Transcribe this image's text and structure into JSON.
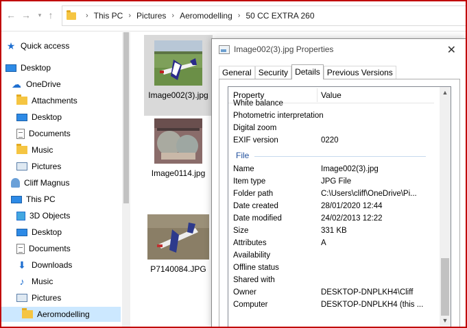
{
  "address_bar": {
    "back_icon": "back-arrow-icon",
    "forward_icon": "forward-arrow-icon",
    "up_icon": "up-arrow-icon",
    "breadcrumbs": [
      "This PC",
      "Pictures",
      "Aeromodelling",
      "50 CC EXTRA 260"
    ]
  },
  "sidebar": {
    "items": [
      {
        "label": "Quick access",
        "icon": "star-icon"
      },
      {
        "label": "Desktop",
        "icon": "desktop-icon"
      },
      {
        "label": "OneDrive",
        "icon": "cloud-icon"
      },
      {
        "label": "Attachments",
        "icon": "folder-icon"
      },
      {
        "label": "Desktop",
        "icon": "desktop-icon"
      },
      {
        "label": "Documents",
        "icon": "document-icon"
      },
      {
        "label": "Music",
        "icon": "folder-icon"
      },
      {
        "label": "Pictures",
        "icon": "pictures-icon"
      },
      {
        "label": "Cliff Magnus",
        "icon": "user-icon"
      },
      {
        "label": "This PC",
        "icon": "computer-icon"
      },
      {
        "label": "3D Objects",
        "icon": "3d-objects-icon"
      },
      {
        "label": "Desktop",
        "icon": "desktop-icon"
      },
      {
        "label": "Documents",
        "icon": "document-icon"
      },
      {
        "label": "Downloads",
        "icon": "download-icon"
      },
      {
        "label": "Music",
        "icon": "music-icon"
      },
      {
        "label": "Pictures",
        "icon": "pictures-icon"
      },
      {
        "label": "Aeromodelling",
        "icon": "folder-icon"
      }
    ]
  },
  "files": [
    {
      "name": "Image002(3).jpg",
      "selected": true
    },
    {
      "name": "Image0114.jpg",
      "selected": false
    },
    {
      "name": "P7140084.JPG",
      "selected": false
    }
  ],
  "dialog": {
    "title": "Image002(3).jpg Properties",
    "tabs": [
      "General",
      "Security",
      "Details",
      "Previous Versions"
    ],
    "active_tab": "Details",
    "columns": {
      "property": "Property",
      "value": "Value"
    },
    "partial_row": "White balance",
    "camera_rows": [
      {
        "key": "Photometric interpretation",
        "value": ""
      },
      {
        "key": "Digital zoom",
        "value": ""
      },
      {
        "key": "EXIF version",
        "value": "0220"
      }
    ],
    "file_section": "File",
    "file_rows": [
      {
        "key": "Name",
        "value": "Image002(3).jpg"
      },
      {
        "key": "Item type",
        "value": "JPG File"
      },
      {
        "key": "Folder path",
        "value": "C:\\Users\\cliff\\OneDrive\\Pi..."
      },
      {
        "key": "Date created",
        "value": "28/01/2020 12:44"
      },
      {
        "key": "Date modified",
        "value": "24/02/2013 12:22"
      },
      {
        "key": "Size",
        "value": "331 KB"
      },
      {
        "key": "Attributes",
        "value": "A"
      },
      {
        "key": "Availability",
        "value": ""
      },
      {
        "key": "Offline status",
        "value": ""
      },
      {
        "key": "Shared with",
        "value": ""
      },
      {
        "key": "Owner",
        "value": "DESKTOP-DNPLKH4\\Cliff"
      },
      {
        "key": "Computer",
        "value": "DESKTOP-DNPLKH4 (this ..."
      }
    ]
  },
  "colors": {
    "frame": "#c00000",
    "selection": "#cce8ff",
    "section": "#1f4e9c"
  }
}
